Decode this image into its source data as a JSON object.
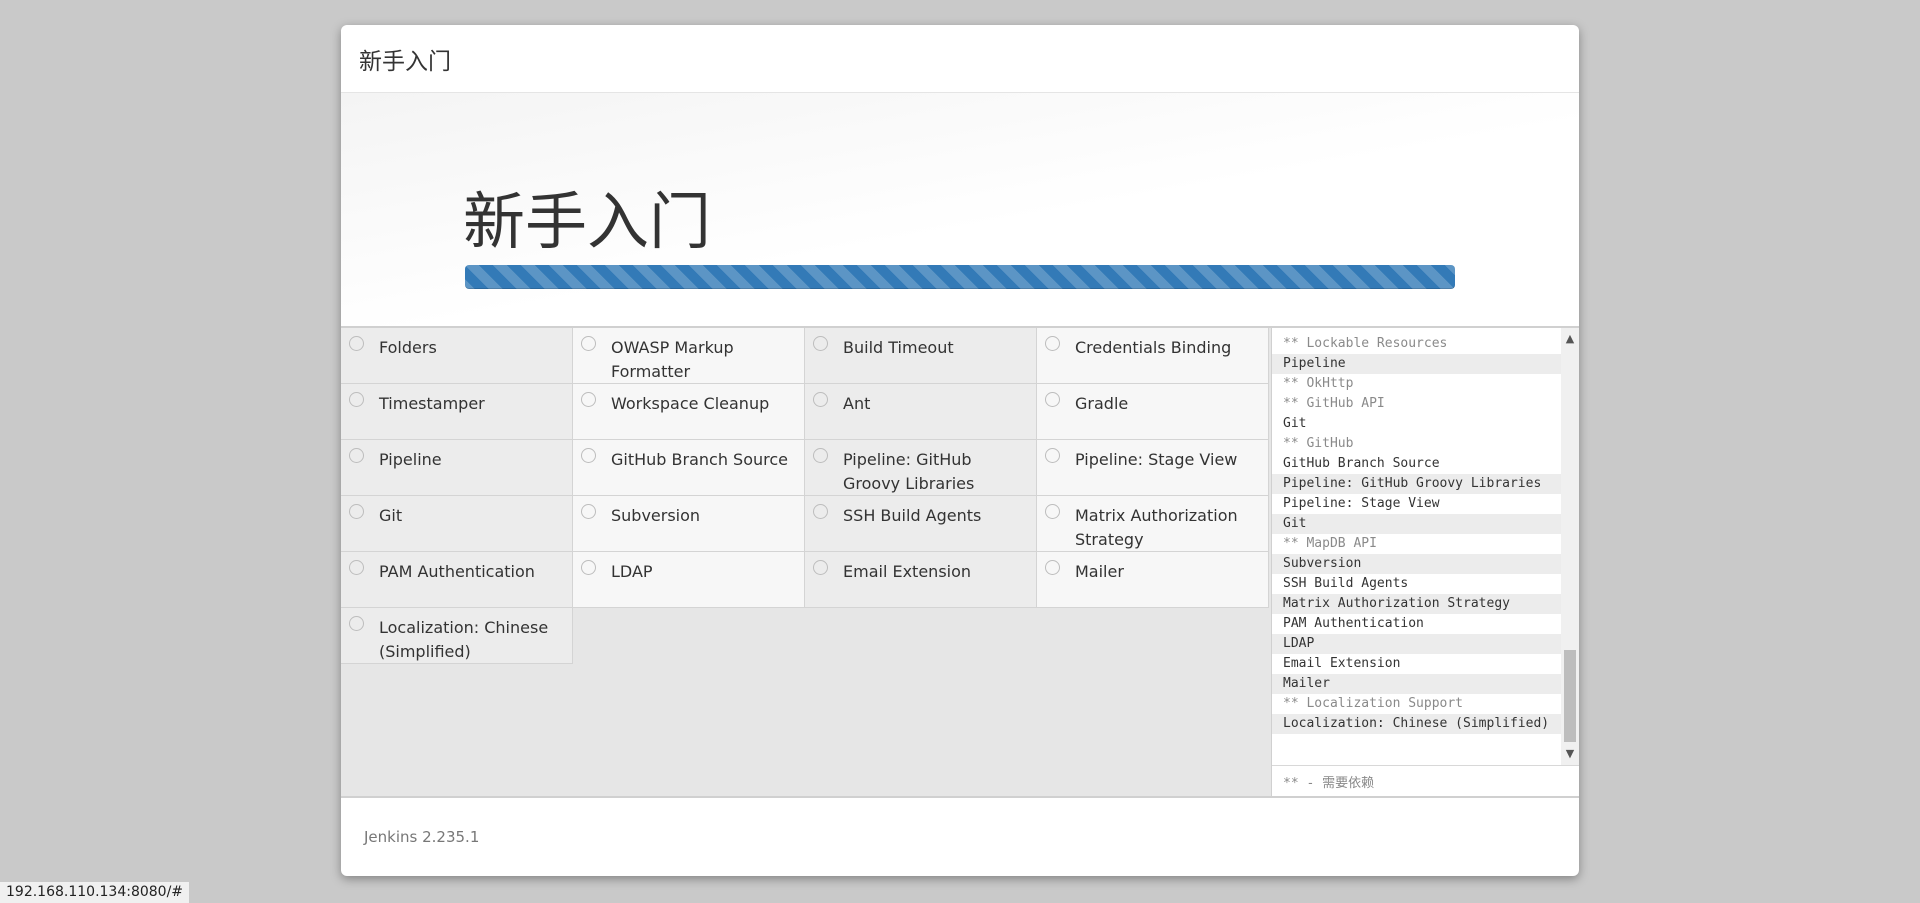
{
  "header": {
    "title": "新手入门"
  },
  "hero": {
    "title": "新手入门",
    "progress": 1.0
  },
  "plugins": [
    "Folders",
    "OWASP Markup Formatter",
    "Build Timeout",
    "Credentials Binding",
    "Timestamper",
    "Workspace Cleanup",
    "Ant",
    "Gradle",
    "Pipeline",
    "GitHub Branch Source",
    "Pipeline: GitHub Groovy Libraries",
    "Pipeline: Stage View",
    "Git",
    "Subversion",
    "SSH Build Agents",
    "Matrix Authorization Strategy",
    "PAM Authentication",
    "LDAP",
    "Email Extension",
    "Mailer",
    "Localization: Chinese (Simplified)"
  ],
  "log": {
    "lines": [
      "** Lockable Resources",
      "Pipeline",
      "** OkHttp",
      "** GitHub API",
      "Git",
      "** GitHub",
      "GitHub Branch Source",
      "Pipeline: GitHub Groovy Libraries",
      "Pipeline: Stage View",
      "Git",
      "** MapDB API",
      "Subversion",
      "SSH Build Agents",
      "Matrix Authorization Strategy",
      "PAM Authentication",
      "LDAP",
      "Email Extension",
      "Mailer",
      "** Localization Support",
      "Localization: Chinese (Simplified)"
    ],
    "footer_note": "** - 需要依赖"
  },
  "footer": {
    "version": "Jenkins 2.235.1"
  },
  "status_bar": {
    "url": "192.168.110.134:8080/#"
  }
}
